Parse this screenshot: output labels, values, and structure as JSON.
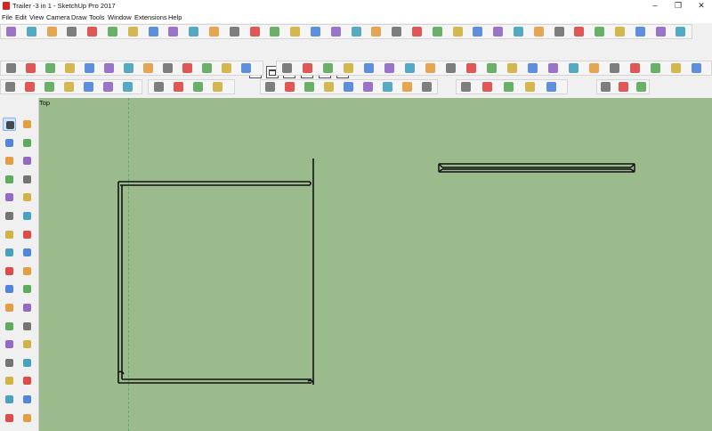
{
  "window": {
    "title": "Trailer -3 in 1 - SketchUp Pro 2017",
    "app_icon": "sketchup-icon",
    "controls": [
      {
        "name": "minimize-button",
        "glyph": "–"
      },
      {
        "name": "maximize-button",
        "glyph": "❐"
      },
      {
        "name": "close-button",
        "glyph": "✕"
      }
    ]
  },
  "menu": [
    "File",
    "Edit",
    "View",
    "Camera",
    "Draw",
    "Tools",
    "Window",
    "Extensions",
    "Help"
  ],
  "toolbars": {
    "views_icons": [
      "iso-view-icon",
      "top-view-icon",
      "front-view-icon",
      "right-view-icon",
      "back-view-icon",
      "left-view-icon"
    ],
    "colors": [
      "#d8231f",
      "#2b6bd6",
      "#e08a18",
      "#3a9a3a",
      "#7b48b8",
      "#555555",
      "#c9a21a",
      "#1f8fb0"
    ]
  },
  "tools": [
    [
      "select-tool-icon",
      "component-tool-icon"
    ],
    [
      "paint-bucket-icon",
      "eraser-icon"
    ],
    [
      "line-tool-icon",
      "freehand-tool-icon"
    ],
    [
      "rectangle-tool-icon",
      "rotated-rectangle-icon"
    ],
    [
      "circle-tool-icon",
      "polygon-tool-icon"
    ],
    [
      "arc-tool-icon",
      "two-point-arc-icon"
    ],
    [
      "three-point-arc-icon",
      "pie-tool-icon"
    ],
    [
      "move-tool-icon",
      "push-pull-icon"
    ],
    [
      "rotate-tool-icon",
      "follow-me-icon"
    ],
    [
      "scale-tool-icon",
      "offset-tool-icon"
    ],
    [
      "tape-measure-icon",
      "dimension-tool-icon"
    ],
    [
      "protractor-icon",
      "text-tool-icon"
    ],
    [
      "axes-tool-icon",
      "3d-text-icon"
    ],
    [
      "orbit-tool-icon",
      "pan-tool-icon"
    ],
    [
      "zoom-tool-icon",
      "zoom-window-icon"
    ],
    [
      "zoom-extents-icon",
      "previous-view-icon"
    ],
    [
      "position-camera-icon",
      "look-around-icon"
    ]
  ],
  "viewport": {
    "scene_label": "Top",
    "background": "#9bbb8c"
  }
}
